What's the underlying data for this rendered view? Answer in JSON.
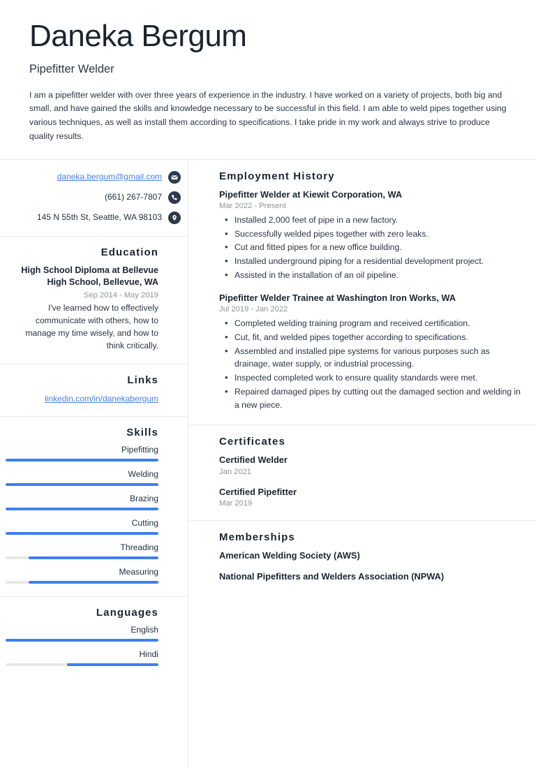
{
  "header": {
    "full_name": "Daneka Bergum",
    "job_title": "Pipefitter Welder",
    "summary": "I am a pipefitter welder with over three years of experience in the industry. I have worked on a variety of projects, both big and small, and have gained the skills and knowledge necessary to be successful in this field. I am able to weld pipes together using various techniques, as well as install them according to specifications. I take pride in my work and always strive to produce quality results."
  },
  "sidebar": {
    "contact": {
      "email": "daneka.bergum@gmail.com",
      "phone": "(661) 267-7807",
      "address": "145 N 55th St, Seattle, WA 98103",
      "email_icon": "envelope-icon",
      "phone_icon": "phone-icon",
      "address_icon": "location-pin-icon"
    },
    "education": {
      "heading": "Education",
      "entries": [
        {
          "degree": "High School Diploma at Bellevue High School, Bellevue, WA",
          "dates": "Sep 2014 - May 2019",
          "description": "I've learned how to effectively communicate with others, how to manage my time wisely, and how to think critically."
        }
      ]
    },
    "links": {
      "heading": "Links",
      "items": [
        {
          "label": "linkedin.com/in/danekabergum"
        }
      ]
    },
    "skills": {
      "heading": "Skills",
      "items": [
        {
          "label": "Pipefitting",
          "level": 100
        },
        {
          "label": "Welding",
          "level": 100
        },
        {
          "label": "Brazing",
          "level": 100
        },
        {
          "label": "Cutting",
          "level": 100
        },
        {
          "label": "Threading",
          "level": 85
        },
        {
          "label": "Measuring",
          "level": 85
        }
      ]
    },
    "languages": {
      "heading": "Languages",
      "items": [
        {
          "label": "English",
          "level": 100
        },
        {
          "label": "Hindi",
          "level": 60
        }
      ]
    }
  },
  "main": {
    "employment": {
      "heading": "Employment History",
      "entries": [
        {
          "title": "Pipefitter Welder at Kiewit Corporation, WA",
          "dates": "Mar 2022 - Present",
          "bullets": [
            "Installed 2,000 feet of pipe in a new factory.",
            "Successfully welded pipes together with zero leaks.",
            "Cut and fitted pipes for a new office building.",
            "Installed underground piping for a residential development project.",
            "Assisted in the installation of an oil pipeline."
          ]
        },
        {
          "title": "Pipefitter Welder Trainee at Washington Iron Works, WA",
          "dates": "Jul 2019 - Jan 2022",
          "bullets": [
            "Completed welding training program and received certification.",
            "Cut, fit, and welded pipes together according to specifications.",
            "Assembled and installed pipe systems for various purposes such as drainage, water supply, or industrial processing.",
            "Inspected completed work to ensure quality standards were met.",
            "Repaired damaged pipes by cutting out the damaged section and welding in a new piece."
          ]
        }
      ]
    },
    "certificates": {
      "heading": "Certificates",
      "entries": [
        {
          "title": "Certified Welder",
          "dates": "Jan 2021"
        },
        {
          "title": "Certified Pipefitter",
          "dates": "Mar 2019"
        }
      ]
    },
    "memberships": {
      "heading": "Memberships",
      "entries": [
        {
          "title": "American Welding Society (AWS)"
        },
        {
          "title": "National Pipefitters and Welders Association (NPWA)"
        }
      ]
    }
  },
  "colors": {
    "accent_blue": "#3d7ff2",
    "link_blue": "#4a7fe8",
    "text_dark": "#1b2431",
    "text_muted": "#8d929a",
    "bar_track": "#e8e8ea",
    "icon_circle": "#2c3a4b"
  }
}
